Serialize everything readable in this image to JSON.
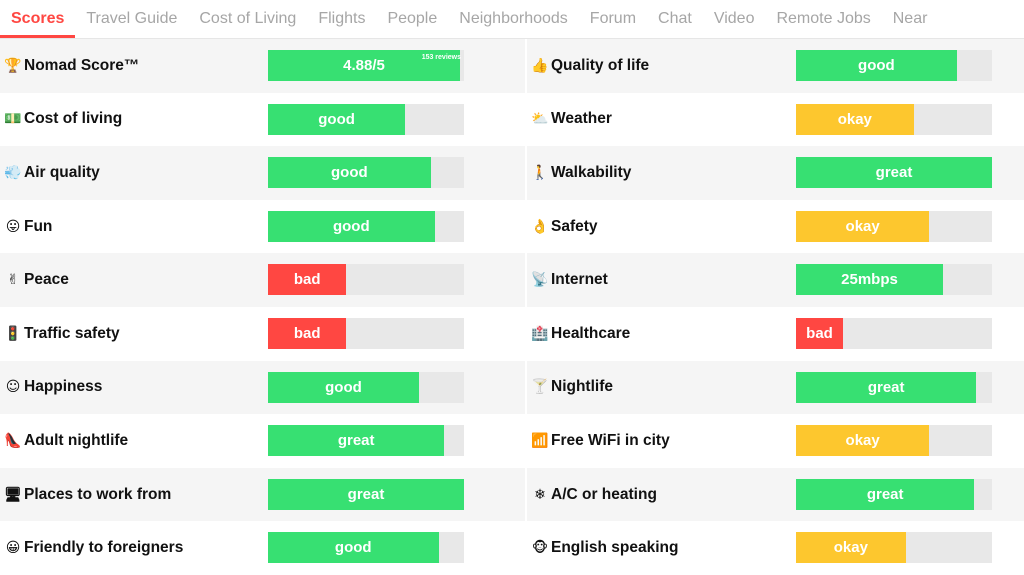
{
  "tabs": [
    {
      "label": "Scores",
      "active": true
    },
    {
      "label": "Travel Guide",
      "active": false
    },
    {
      "label": "Cost of Living",
      "active": false
    },
    {
      "label": "Flights",
      "active": false
    },
    {
      "label": "People",
      "active": false
    },
    {
      "label": "Neighborhoods",
      "active": false
    },
    {
      "label": "Forum",
      "active": false
    },
    {
      "label": "Chat",
      "active": false
    },
    {
      "label": "Video",
      "active": false
    },
    {
      "label": "Remote Jobs",
      "active": false
    },
    {
      "label": "Near",
      "active": false
    }
  ],
  "colors": {
    "green": "#37e072",
    "yellow": "#fdc72e",
    "red": "#ff4742",
    "accent": "#ff4742"
  },
  "left": [
    {
      "label": "Nomad Score™",
      "icon": "trophy-icon",
      "glyph": "🏆",
      "value": "4.88/5",
      "level": 0.98,
      "color": "green",
      "reviews": "153 reviews"
    },
    {
      "label": "Cost of living",
      "icon": "money-icon",
      "glyph": "💵",
      "value": "good",
      "level": 0.7,
      "color": "green"
    },
    {
      "label": "Air quality",
      "icon": "wind-icon",
      "glyph": "💨",
      "value": "good",
      "level": 0.83,
      "color": "green"
    },
    {
      "label": "Fun",
      "icon": "tongue-face-icon",
      "glyph": "😛",
      "value": "good",
      "level": 0.85,
      "color": "green"
    },
    {
      "label": "Peace",
      "icon": "peace-hand-icon",
      "glyph": "✌",
      "value": "bad",
      "level": 0.4,
      "color": "red"
    },
    {
      "label": "Traffic safety",
      "icon": "traffic-light-icon",
      "glyph": "🚦",
      "value": "bad",
      "level": 0.4,
      "color": "red"
    },
    {
      "label": "Happiness",
      "icon": "smile-icon",
      "glyph": "☺",
      "value": "good",
      "level": 0.77,
      "color": "green"
    },
    {
      "label": "Adult nightlife",
      "icon": "high-heel-icon",
      "glyph": "👠",
      "value": "great",
      "level": 0.9,
      "color": "green"
    },
    {
      "label": "Places to work from",
      "icon": "monitor-icon",
      "glyph": "🖥",
      "value": "great",
      "level": 1.0,
      "color": "green"
    },
    {
      "label": "Friendly to foreigners",
      "icon": "grin-icon",
      "glyph": "😀",
      "value": "good",
      "level": 0.87,
      "color": "green"
    }
  ],
  "right": [
    {
      "label": "Quality of life",
      "icon": "thumbs-up-icon",
      "glyph": "👍",
      "value": "good",
      "level": 0.82,
      "color": "green"
    },
    {
      "label": "Weather",
      "icon": "cloud-icon",
      "glyph": "⛅",
      "value": "okay",
      "level": 0.6,
      "color": "yellow"
    },
    {
      "label": "Walkability",
      "icon": "walker-icon",
      "glyph": "🚶",
      "value": "great",
      "level": 1.0,
      "color": "green"
    },
    {
      "label": "Safety",
      "icon": "ok-hand-icon",
      "glyph": "👌",
      "value": "okay",
      "level": 0.68,
      "color": "yellow"
    },
    {
      "label": "Internet",
      "icon": "satellite-icon",
      "glyph": "📡",
      "value": "25mbps",
      "level": 0.75,
      "color": "green"
    },
    {
      "label": "Healthcare",
      "icon": "hospital-icon",
      "glyph": "🏥",
      "value": "bad",
      "level": 0.24,
      "color": "red"
    },
    {
      "label": "Nightlife",
      "icon": "cocktail-icon",
      "glyph": "🍸",
      "value": "great",
      "level": 0.92,
      "color": "green"
    },
    {
      "label": "Free WiFi in city",
      "icon": "signal-icon",
      "glyph": "📶",
      "value": "okay",
      "level": 0.68,
      "color": "yellow"
    },
    {
      "label": "A/C or heating",
      "icon": "snowflake-icon",
      "glyph": "❄",
      "value": "great",
      "level": 0.91,
      "color": "green"
    },
    {
      "label": "English speaking",
      "icon": "monkey-icon",
      "glyph": "🐵",
      "value": "okay",
      "level": 0.56,
      "color": "yellow"
    }
  ]
}
